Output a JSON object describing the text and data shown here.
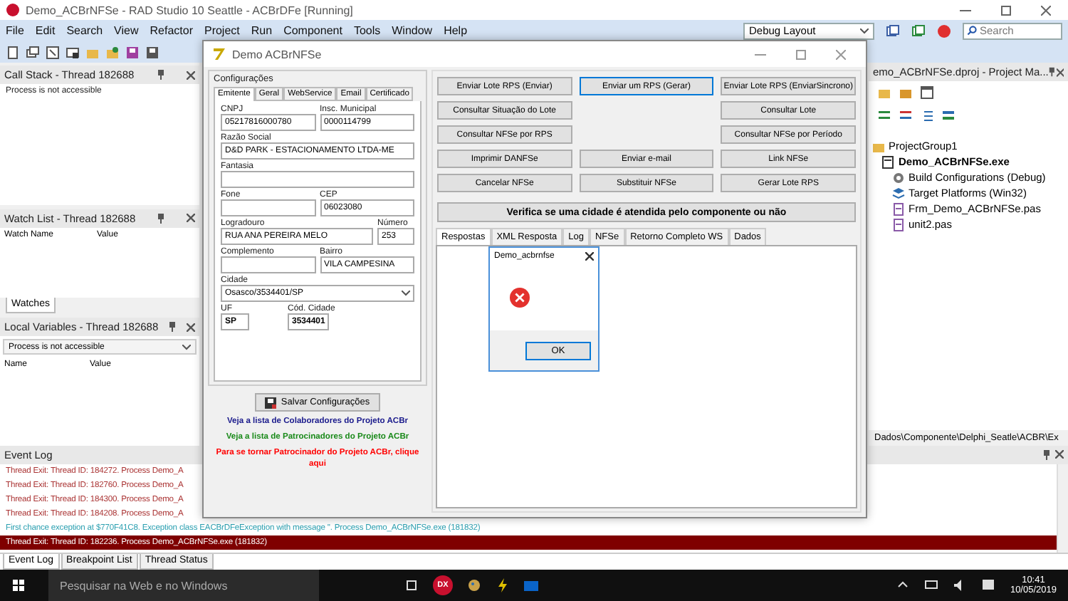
{
  "ide": {
    "title": "Demo_ACBrNFSe - RAD Studio 10 Seattle - ACBrDFe [Running]",
    "menu": [
      "File",
      "Edit",
      "Search",
      "View",
      "Refactor",
      "Project",
      "Run",
      "Component",
      "Tools",
      "Window",
      "Help"
    ],
    "layout": "Debug Layout",
    "search_placeholder": "Search"
  },
  "call_stack": {
    "title": "Call Stack - Thread 182688",
    "message": "Process is not accessible"
  },
  "watch_list": {
    "title": "Watch List - Thread 182688",
    "columns": [
      "Watch Name",
      "Value"
    ],
    "tab": "Watches"
  },
  "local_variables": {
    "title": "Local Variables - Thread 182688",
    "select": "Process is not accessible",
    "columns": [
      "Name",
      "Value"
    ]
  },
  "project_manager": {
    "title": "emo_ACBrNFSe.dproj - Project Ma...",
    "tree": [
      {
        "label": "ProjectGroup1",
        "kind": "group",
        "active": false,
        "children": [
          {
            "label": "Demo_ACBrNFSe.exe",
            "kind": "project",
            "active": true,
            "children": [
              {
                "label": "Build Configurations (Debug)",
                "kind": "config",
                "active": false
              },
              {
                "label": "Target Platforms (Win32)",
                "kind": "platforms",
                "active": false
              },
              {
                "label": "Frm_Demo_ACBrNFSe.pas",
                "kind": "unit",
                "active": false
              },
              {
                "label": "unit2.pas",
                "kind": "unit",
                "active": false
              }
            ]
          }
        ]
      }
    ],
    "path": "Dados\\Componente\\Delphi_Seatle\\ACBR\\Ex"
  },
  "event_log": {
    "title": "Event Log",
    "lines": [
      {
        "text": "Thread Exit: Thread ID: 184272. Process Demo_A",
        "kind": "thread",
        "selected": false
      },
      {
        "text": "Thread Exit: Thread ID: 182760. Process Demo_A",
        "kind": "thread",
        "selected": false
      },
      {
        "text": "Thread Exit: Thread ID: 184300. Process Demo_A",
        "kind": "thread",
        "selected": false
      },
      {
        "text": "Thread Exit: Thread ID: 184208. Process Demo_A",
        "kind": "thread",
        "selected": false
      },
      {
        "text": "First chance exception at $770F41C8. Exception class EACBrDFeException with message ''. Process Demo_ACBrNFSe.exe (181832)",
        "kind": "exception",
        "selected": false
      },
      {
        "text": "Thread Exit: Thread ID: 182236. Process Demo_ACBrNFSe.exe (181832)",
        "kind": "thread",
        "selected": true
      }
    ],
    "tabs": [
      {
        "label": "Event Log",
        "selected": true
      },
      {
        "label": "Breakpoint List",
        "selected": false
      },
      {
        "label": "Thread Status",
        "selected": false
      }
    ]
  },
  "taskbar": {
    "search_placeholder": "Pesquisar na Web e no Windows",
    "app_badge": "DX",
    "time": "10:41",
    "date": "10/05/2019"
  },
  "demo": {
    "title": "Demo ACBrNFSe",
    "group": "Configurações",
    "tabs": [
      {
        "label": "Emitente",
        "selected": true
      },
      {
        "label": "Geral",
        "selected": false
      },
      {
        "label": "WebService",
        "selected": false
      },
      {
        "label": "Email",
        "selected": false
      },
      {
        "label": "Certificado",
        "selected": false
      }
    ],
    "rows": [
      {
        "fields": [
          {
            "label": "CNPJ",
            "value": "05217816000780",
            "kind": "text"
          },
          {
            "label": "Insc. Municipal",
            "value": "0000114799",
            "kind": "text"
          }
        ]
      },
      {
        "fields": [
          {
            "label": "Razão Social",
            "value": "D&D PARK - ESTACIONAMENTO LTDA-ME",
            "kind": "text"
          }
        ]
      },
      {
        "fields": [
          {
            "label": "Fantasia",
            "kind": "text"
          }
        ]
      },
      {
        "fields": [
          {
            "label": "Fone",
            "kind": "text"
          },
          {
            "label": "CEP",
            "value": "06023080",
            "kind": "text"
          }
        ]
      },
      {
        "fields": [
          {
            "label": "Logradouro",
            "value": "RUA ANA PEREIRA MELO",
            "kind": "text"
          },
          {
            "label": "Número",
            "value": "253",
            "kind": "short"
          }
        ]
      },
      {
        "fields": [
          {
            "label": "Complemento",
            "kind": "text"
          },
          {
            "label": "Bairro",
            "value": "VILA CAMPESINA",
            "kind": "text"
          }
        ]
      },
      {
        "fields": [
          {
            "label": "Cidade",
            "value": "Osasco/3534401/SP",
            "kind": "select"
          }
        ]
      },
      {
        "fields": [
          {
            "label": "UF",
            "value": "SP",
            "kind": "code"
          },
          {
            "label": "Cód. Cidade",
            "value": "3534401",
            "kind": "code"
          }
        ]
      }
    ],
    "save_button": "Salvar Configurações",
    "links": [
      {
        "text": "Veja a lista de Colaboradores do Projeto ACBr",
        "color": "#1a1a8c"
      },
      {
        "text": "Veja a lista de Patrocinadores do Projeto ACBr",
        "color": "#1a8a1a"
      },
      {
        "text": "Para se tornar Patrocinador do Projeto ACBr, clique aqui",
        "color": "#ff0000"
      }
    ],
    "button_rows": [
      {
        "left": {
          "label": "Enviar Lote RPS (Enviar)",
          "focused": false
        },
        "middle": {
          "label": "Enviar um RPS (Gerar)",
          "focused": true
        },
        "right": {
          "label": "Enviar Lote RPS (EnviarSincrono)",
          "focused": false
        }
      },
      {
        "left": {
          "label": "Consultar Situação do Lote",
          "focused": false
        },
        "right": {
          "label": "Consultar Lote",
          "focused": false
        }
      },
      {
        "left": {
          "label": "Consultar NFSe por RPS",
          "focused": false
        },
        "right": {
          "label": "Consultar NFSe por Período",
          "focused": false
        }
      },
      {
        "left": {
          "label": "Imprimir DANFSe",
          "focused": false
        },
        "middle": {
          "label": "Enviar e-mail",
          "focused": false
        },
        "right": {
          "label": "Link NFSe",
          "focused": false
        }
      },
      {
        "left": {
          "label": "Cancelar NFSe",
          "focused": false
        },
        "middle": {
          "label": "Substituir NFSe",
          "focused": false
        },
        "right": {
          "label": "Gerar Lote RPS",
          "focused": false
        }
      }
    ],
    "verify_button": "Verifica se uma cidade é atendida pelo componente ou não",
    "result_tabs": [
      {
        "label": "Respostas",
        "selected": true
      },
      {
        "label": "XML Resposta",
        "selected": false
      },
      {
        "label": "Log",
        "selected": false
      },
      {
        "label": "NFSe",
        "selected": false
      },
      {
        "label": "Retorno Completo WS",
        "selected": false
      },
      {
        "label": "Dados",
        "selected": false
      }
    ],
    "dialog": {
      "title": "Demo_acbrnfse",
      "button": "OK"
    }
  }
}
